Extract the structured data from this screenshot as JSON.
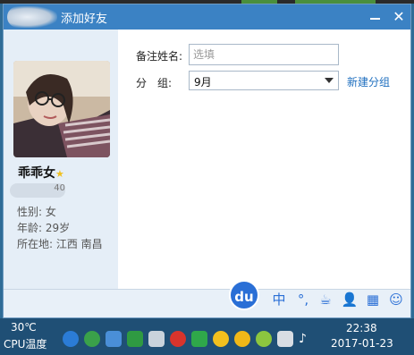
{
  "window": {
    "title": "添加好友",
    "minimize_symbol": "",
    "close_symbol": "✕"
  },
  "profile": {
    "nickname": "乖乖女",
    "id_partial": "40",
    "gender": "性别: 女",
    "age": "年龄: 29岁",
    "location": "所在地: 江西  南昌"
  },
  "form": {
    "remark_label": "备注姓名:",
    "remark_placeholder": "选填",
    "group_label": "分　组:",
    "group_value": "9月",
    "new_group_link": "新建分组"
  },
  "ime_toolbar": {
    "logo": "du",
    "items": [
      "中",
      "°,",
      "☕",
      "👤",
      "▦",
      "☺"
    ]
  },
  "taskbar": {
    "temperature": "30℃",
    "cpu_label": "CPU温度",
    "time": "22:38",
    "date": "2017-01-23",
    "tray_icons": [
      "media-player",
      "browser",
      "package",
      "shield",
      "tool",
      "weibo",
      "check",
      "qq",
      "qq2",
      "game",
      "network",
      "volume"
    ]
  },
  "colors": {
    "titlebar": "#3b82c4",
    "left_panel": "#e5eef7",
    "link": "#1f6fbf",
    "taskbar": "#1f4f75"
  }
}
